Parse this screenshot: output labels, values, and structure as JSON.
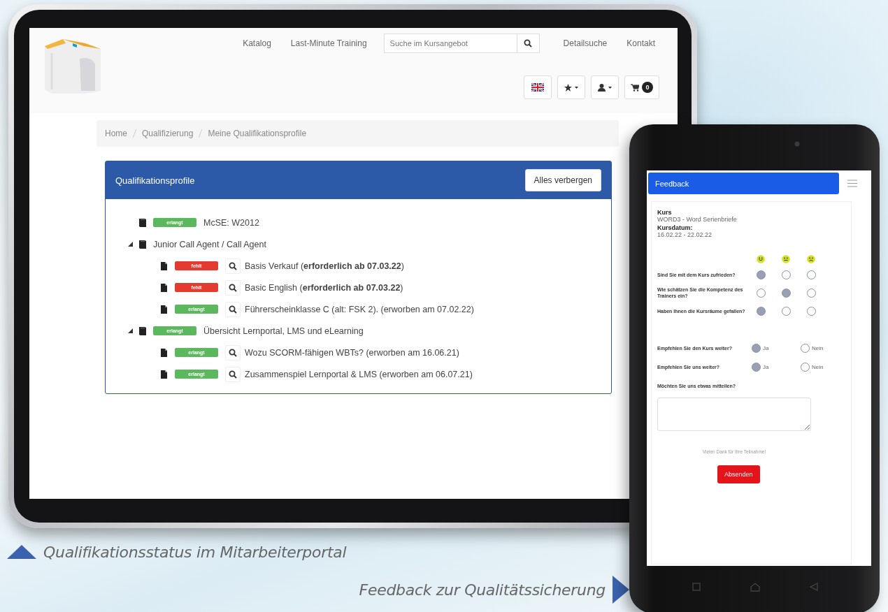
{
  "tablet": {
    "nav_links": [
      {
        "label": "Katalog"
      },
      {
        "label": "Last-Minute Training"
      }
    ],
    "search": {
      "placeholder": "Suche im Kursangebot"
    },
    "nav_links_right": [
      {
        "label": "Detailsuche"
      },
      {
        "label": "Kontakt"
      }
    ],
    "cart_count": "0",
    "breadcrumb": [
      "Home",
      "Qualifizierung",
      "Meine Qualifikationsprofile"
    ],
    "panel": {
      "title": "Qualifikationsprofile",
      "button": "Alles verbergen",
      "tree": [
        {
          "kind": "group",
          "badge": {
            "label": "erlangt",
            "color": "#5cb85c"
          },
          "text": "McSE: W2012"
        },
        {
          "kind": "group",
          "text": "Junior Call Agent / Call Agent",
          "children": [
            {
              "kind": "course",
              "badge": {
                "label": "fehlt",
                "color": "#e53a2f"
              },
              "text": "Basis Verkauf (**erforderlich ab 07.03.22**)"
            },
            {
              "kind": "course",
              "badge": {
                "label": "fehlt",
                "color": "#e53a2f"
              },
              "text": "Basic English (**erforderlich ab 07.03.22**)"
            },
            {
              "kind": "course",
              "badge": {
                "label": "erlangt",
                "color": "#5cb85c"
              },
              "text": "Führerscheinklasse C (alt: FSK 2). (erworben am 07.02.22)"
            }
          ]
        },
        {
          "kind": "group",
          "badge": {
            "label": "erlangt",
            "color": "#5cb85c"
          },
          "text": "Übersicht Lernportal, LMS und eLearning",
          "children": [
            {
              "kind": "course",
              "badge": {
                "label": "erlangt",
                "color": "#5cb85c"
              },
              "text": "Wozu SCORM-fähigen WBTs? (erworben am 16.06.21)"
            },
            {
              "kind": "course",
              "badge": {
                "label": "erlangt",
                "color": "#5cb85c"
              },
              "text": "Zusammenspiel Lernportal & LMS (erworben am 06.07.21)"
            }
          ]
        }
      ]
    }
  },
  "phone": {
    "title": "Feedback",
    "course_label": "Kurs",
    "course": "WORD3 - Word Serienbriefe",
    "date_label": "Kursdatum:",
    "date": "16.02.22 - 22.02.22",
    "ratings": [
      {
        "question": "Sind Sie mit dem Kurs zufrieden?",
        "options": [
          {
            "selected": true
          },
          {
            "selected": false
          },
          {
            "selected": false
          }
        ]
      },
      {
        "question": "Wie schätzen Sie die Kompetenz des Trainers ein?",
        "options": [
          {
            "selected": false
          },
          {
            "selected": true
          },
          {
            "selected": false
          }
        ]
      },
      {
        "question": "Haben Ihnen die Kursräume gefallen?",
        "options": [
          {
            "selected": true
          },
          {
            "selected": false
          },
          {
            "selected": false
          }
        ]
      }
    ],
    "yes_no": [
      {
        "question": "Empfehlen Sie den Kurs weiter?",
        "options": [
          {
            "label": "Ja",
            "selected": true
          },
          {
            "label": "Nein",
            "selected": false
          }
        ]
      },
      {
        "question": "Empfehlen Sie uns weiter?",
        "options": [
          {
            "label": "Ja",
            "selected": true
          },
          {
            "label": "Nein",
            "selected": false
          }
        ]
      }
    ],
    "comment": {
      "label": "Möchten Sie uns etwas mitteilen?"
    },
    "thanks": "Vielen Dank für Ihre Teilnahme!",
    "submit": "Absenden"
  },
  "captions": [
    {
      "kind": "up",
      "text": "Qualifikationsstatus im Mitarbeiterportal"
    },
    {
      "kind": "right",
      "text": "Feedback zur Qualitätssicherung"
    }
  ]
}
